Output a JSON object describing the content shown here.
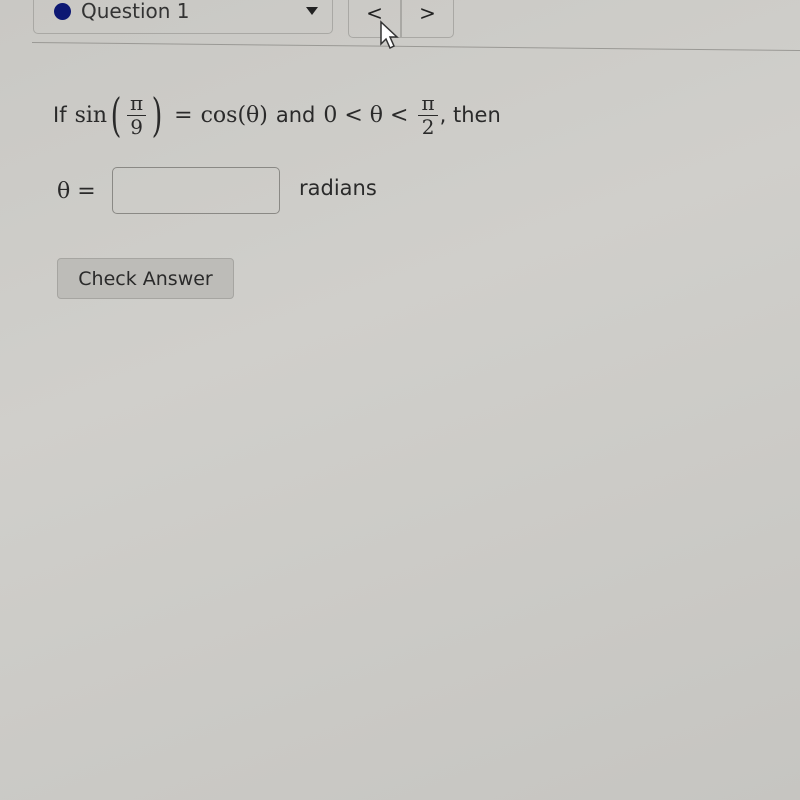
{
  "header": {
    "question_selector": {
      "label": "Question 1",
      "status_dot_color": "#0d1873"
    },
    "prev_button": {
      "label": "<"
    },
    "next_button": {
      "label": ">"
    }
  },
  "question": {
    "prefix": "If",
    "sin": "sin",
    "sin_arg_numerator": "π",
    "sin_arg_denominator": "9",
    "equals": "=",
    "cos_expr": "cos(θ)",
    "and": "and",
    "inequality": "0 < θ <",
    "bound_numerator": "π",
    "bound_denominator": "2",
    "suffix": ", then"
  },
  "answer": {
    "variable": "θ =",
    "value": "",
    "placeholder": "",
    "unit": "radians"
  },
  "check_button": {
    "label": "Check Answer"
  }
}
